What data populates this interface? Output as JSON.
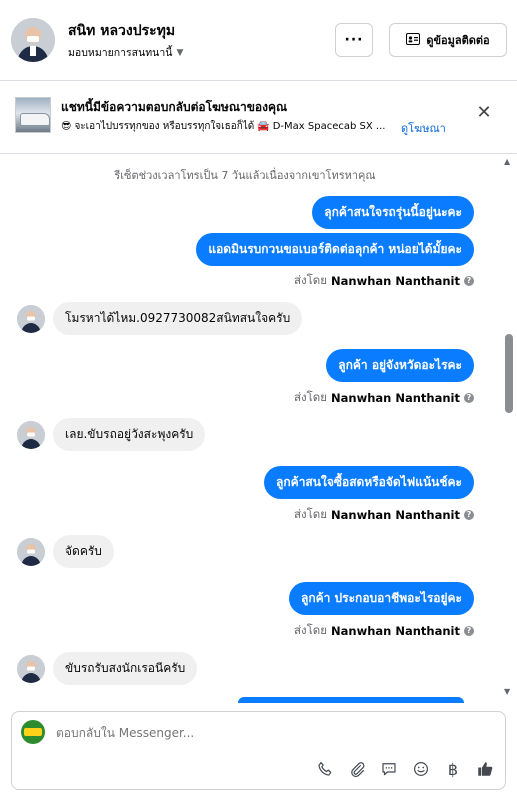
{
  "header": {
    "name": "สนิท หลวงประทุม",
    "subtitle": "มอบหมายการสนทนานี้",
    "more_label": "···",
    "contact_button_label": "ดูข้อมูลติดต่อ"
  },
  "ad": {
    "title": "แชทนี้มีข้อความตอบกลับต่อโฆษณาของคุณ",
    "subtitle": "จะเอาไปบรรทุกของ หรือบรรทุกใจเธอก็ได้",
    "product": "D-Max Spacecab SX ...",
    "link_label": "ดูโฆษณา"
  },
  "notice": "รีเซ็ตช่วงเวลาโทรเป็น 7 วันแล้วเนื่องจากเขาโทรหาคุณ",
  "sent_by_prefix": "ส่งโดย",
  "sender_name": "Nanwhan Nanthanit",
  "messages": {
    "out_1": "ลุกค้าสนใจรถรุ่นนี้อยู่นะคะ",
    "out_2": "แอดมินรบกวนขอเบอร์ติดต่อลุกค้า  หน่อยได้มั้ยคะ",
    "in_1": "โมรหาได้ไหม.0927730082สนิทสนใจครับ",
    "out_3": "ลูกค้า อยู่จังหวัดอะไรคะ",
    "in_2": "เลย.ขับรถอยู่วังสะพุงครับ",
    "out_4": "ลูกค้าสนใจซื้อสดหรือจัดไฟแน้นช์คะ",
    "in_3": "จัดครับ",
    "out_5": "ลูกค้า ประกอบอาชีพอะไรอยู่คะ",
    "in_4": "ขับรถรับสงนักเรอนีครับ"
  },
  "composer": {
    "placeholder": "ตอบกลับใน Messenger..."
  },
  "icons": {
    "call": "phone-icon",
    "attach": "paperclip-icon",
    "saved_replies": "chat-bubble-icon",
    "emoji": "smiley-icon",
    "payment": "baht-icon",
    "like": "thumbs-up-icon"
  }
}
